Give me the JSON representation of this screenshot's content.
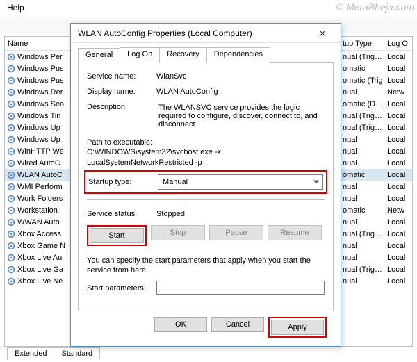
{
  "menu": {
    "help": "Help"
  },
  "columns": {
    "name": "Name",
    "startup_type": "tup Type",
    "logon": "Log O"
  },
  "services": [
    {
      "name": "Windows Per",
      "type": "nual (Trig…",
      "log": "Local"
    },
    {
      "name": "Windows Pus",
      "type": "omatic",
      "log": "Local"
    },
    {
      "name": "Windows Pus",
      "type": "omatic (Trig…",
      "log": "Local"
    },
    {
      "name": "Windows Rer",
      "type": "nual",
      "log": "Netw"
    },
    {
      "name": "Windows Sea",
      "type": "omatic (D…",
      "log": "Local"
    },
    {
      "name": "Windows Tin",
      "type": "nual (Trig…",
      "log": "Local"
    },
    {
      "name": "Windows Up",
      "type": "nual (Trig…",
      "log": "Local"
    },
    {
      "name": "Windows Up",
      "type": "nual",
      "log": "Local"
    },
    {
      "name": "WinHTTP We",
      "type": "nual",
      "log": "Local"
    },
    {
      "name": "Wired AutoC",
      "type": "nual",
      "log": "Local"
    },
    {
      "name": "WLAN AutoC",
      "type": "omatic",
      "log": "Local",
      "selected": true
    },
    {
      "name": "WMI Perform",
      "type": "nual",
      "log": "Local"
    },
    {
      "name": "Work Folders",
      "type": "nual",
      "log": "Local"
    },
    {
      "name": "Workstation",
      "type": "omatic",
      "log": "Netw"
    },
    {
      "name": "WWAN Auto",
      "type": "nual",
      "log": "Local"
    },
    {
      "name": "Xbox Access",
      "type": "nual (Trig…",
      "log": "Local"
    },
    {
      "name": "Xbox Game N",
      "type": "nual",
      "log": "Local"
    },
    {
      "name": "Xbox Live Au",
      "type": "nual",
      "log": "Local"
    },
    {
      "name": "Xbox Live Ga",
      "type": "nual (Trig…",
      "log": "Local"
    },
    {
      "name": "Xbox Live Ne",
      "type": "nual",
      "log": "Local"
    }
  ],
  "bg_tabs": {
    "extended": "Extended",
    "standard": "Standard"
  },
  "dialog": {
    "title": "WLAN AutoConfig Properties (Local Computer)",
    "tabs": {
      "general": "General",
      "logon": "Log On",
      "recovery": "Recovery",
      "dependencies": "Dependencies"
    },
    "labels": {
      "service_name": "Service name:",
      "display_name": "Display name:",
      "description": "Description:",
      "path_label": "Path to executable:",
      "startup_type": "Startup type:",
      "service_status": "Service status:",
      "start_params": "Start parameters:"
    },
    "values": {
      "service_name": "WlanSvc",
      "display_name": "WLAN AutoConfig",
      "description": "The WLANSVC service provides the logic required to configure, discover, connect to, and disconnect",
      "path": "C:\\WINDOWS\\system32\\svchost.exe -k LocalSystemNetworkRestricted -p",
      "startup_type": "Manual",
      "status": "Stopped",
      "start_params": ""
    },
    "buttons": {
      "start": "Start",
      "stop": "Stop",
      "pause": "Pause",
      "resume": "Resume",
      "ok": "OK",
      "cancel": "Cancel",
      "apply": "Apply"
    },
    "note": "You can specify the start parameters that apply when you start the service from here."
  },
  "watermark": "© MeraBheja.com"
}
